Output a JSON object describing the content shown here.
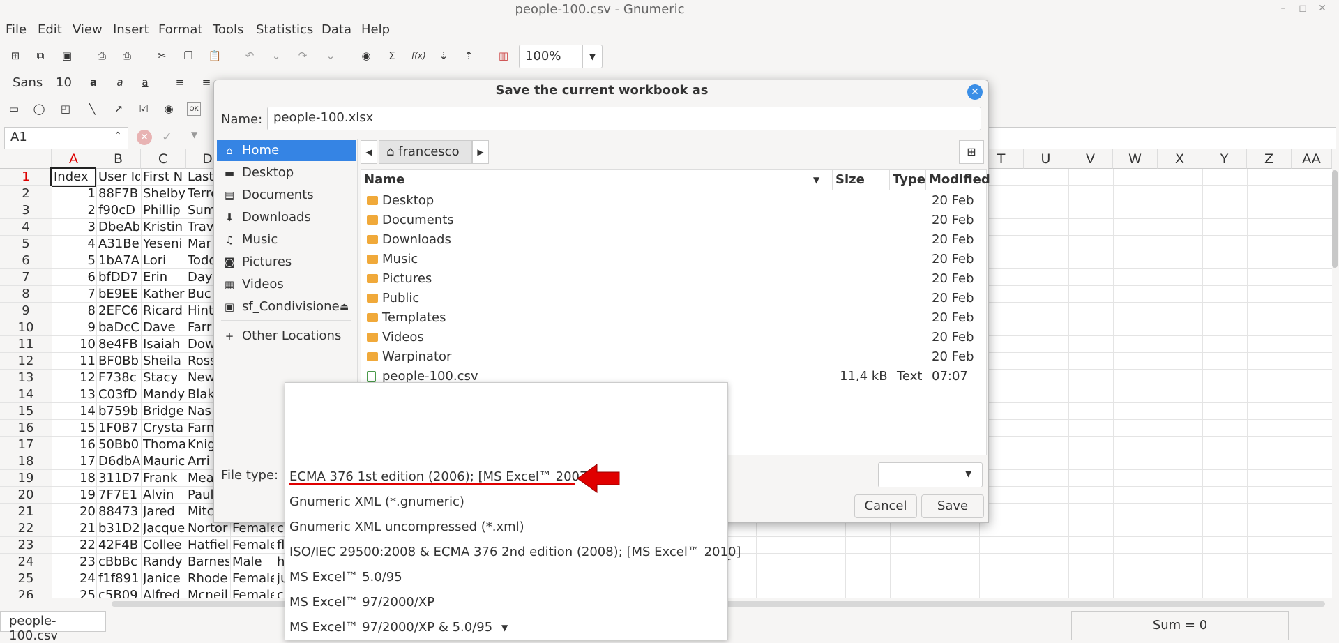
{
  "window": {
    "title": "people-100.csv - Gnumeric"
  },
  "menus": [
    "File",
    "Edit",
    "View",
    "Insert",
    "Format",
    "Tools",
    "Statistics",
    "Data",
    "Help"
  ],
  "toolbar": {
    "zoom": "100%",
    "font_name": "Sans",
    "font_size": "10"
  },
  "cell_ref": "A1",
  "sheet": {
    "columns_left": [
      "A",
      "B",
      "C",
      "D"
    ],
    "columns_right": [
      "T",
      "U",
      "V",
      "W",
      "X",
      "Y",
      "Z",
      "AA"
    ],
    "rows": [
      {
        "n": "1",
        "a": "Index",
        "b": "User Id",
        "c": "First N",
        "d": "Last"
      },
      {
        "n": "2",
        "a": "1",
        "b": "88F7B",
        "c": "Shelby",
        "d": "Terre"
      },
      {
        "n": "3",
        "a": "2",
        "b": "f90cD",
        "c": "Phillip",
        "d": "Sum"
      },
      {
        "n": "4",
        "a": "3",
        "b": "DbeAb",
        "c": "Kristin",
        "d": "Trav"
      },
      {
        "n": "5",
        "a": "4",
        "b": "A31Be",
        "c": "Yeseni",
        "d": "Mar"
      },
      {
        "n": "6",
        "a": "5",
        "b": "1bA7A",
        "c": "Lori",
        "d": "Todd"
      },
      {
        "n": "7",
        "a": "6",
        "b": "bfDD7",
        "c": "Erin",
        "d": "Day"
      },
      {
        "n": "8",
        "a": "7",
        "b": "bE9EE",
        "c": "Kather",
        "d": "Buc"
      },
      {
        "n": "9",
        "a": "8",
        "b": "2EFC6",
        "c": "Ricard",
        "d": "Hint"
      },
      {
        "n": "10",
        "a": "9",
        "b": "baDcC",
        "c": "Dave",
        "d": "Farr"
      },
      {
        "n": "11",
        "a": "10",
        "b": "8e4FB",
        "c": "Isaiah",
        "d": "Dow"
      },
      {
        "n": "12",
        "a": "11",
        "b": "BF0Bb",
        "c": "Sheila",
        "d": "Ross"
      },
      {
        "n": "13",
        "a": "12",
        "b": "F738c",
        "c": "Stacy",
        "d": "New"
      },
      {
        "n": "14",
        "a": "13",
        "b": "C03fD",
        "c": "Mandy",
        "d": "Blak"
      },
      {
        "n": "15",
        "a": "14",
        "b": "b759b",
        "c": "Bridge",
        "d": "Nas"
      },
      {
        "n": "16",
        "a": "15",
        "b": "1F0B7",
        "c": "Crysta",
        "d": "Farn"
      },
      {
        "n": "17",
        "a": "16",
        "b": "50Bb0",
        "c": "Thoma",
        "d": "Knig"
      },
      {
        "n": "18",
        "a": "17",
        "b": "D6dbA",
        "c": "Mauric",
        "d": "Arri"
      },
      {
        "n": "19",
        "a": "18",
        "b": "311D7",
        "c": "Frank",
        "d": "Mea"
      },
      {
        "n": "20",
        "a": "19",
        "b": "7F7E1",
        "c": "Alvin",
        "d": "Paul"
      },
      {
        "n": "21",
        "a": "20",
        "b": "88473",
        "c": "Jared",
        "d": "Mitc"
      },
      {
        "n": "22",
        "a": "21",
        "b": "b31D2",
        "c": "Jacque",
        "d": "Nortor",
        "e": "Female",
        "f": "c"
      },
      {
        "n": "23",
        "a": "22",
        "b": "42F4B",
        "c": "Collee",
        "d": "Hatfiel",
        "e": "Female",
        "f": "fl"
      },
      {
        "n": "24",
        "a": "23",
        "b": "cBbBc",
        "c": "Randy",
        "d": "Barnes",
        "e": "Male",
        "f": "h",
        "r": "r"
      },
      {
        "n": "25",
        "a": "24",
        "b": "f1f891",
        "c": "Janice",
        "d": "Rhode",
        "e": "Female",
        "f": "ju"
      },
      {
        "n": "26",
        "a": "25",
        "b": "c5B09",
        "c": "Alfred",
        "d": "Mcneil",
        "e": "Female",
        "f": "c"
      }
    ]
  },
  "sheet_tab": "people-100.csv",
  "status": {
    "sum": "Sum = 0"
  },
  "dialog": {
    "title": "Save the current workbook as",
    "name_label": "Name:",
    "name_value": "people-100.xlsx",
    "places": [
      "Home",
      "Desktop",
      "Documents",
      "Downloads",
      "Music",
      "Pictures",
      "Videos",
      "sf_Condivisione"
    ],
    "other_locations": "Other Locations",
    "path": "francesco",
    "columns": {
      "name": "Name",
      "size": "Size",
      "type": "Type",
      "modified": "Modified"
    },
    "files": [
      {
        "name": "Desktop",
        "size": "",
        "type": "",
        "modified": "20 Feb"
      },
      {
        "name": "Documents",
        "size": "",
        "type": "",
        "modified": "20 Feb"
      },
      {
        "name": "Downloads",
        "size": "",
        "type": "",
        "modified": "20 Feb"
      },
      {
        "name": "Music",
        "size": "",
        "type": "",
        "modified": "20 Feb"
      },
      {
        "name": "Pictures",
        "size": "",
        "type": "",
        "modified": "20 Feb"
      },
      {
        "name": "Public",
        "size": "",
        "type": "",
        "modified": "20 Feb"
      },
      {
        "name": "Templates",
        "size": "",
        "type": "",
        "modified": "20 Feb"
      },
      {
        "name": "Videos",
        "size": "",
        "type": "",
        "modified": "20 Feb"
      },
      {
        "name": "Warpinator",
        "size": "",
        "type": "",
        "modified": "20 Feb"
      },
      {
        "name": "people-100.csv",
        "size": "11,4 kB",
        "type": "Text",
        "modified": "07:07"
      }
    ],
    "file_type_label": "File type:",
    "cancel": "Cancel",
    "save": "Save",
    "file_types": [
      "ECMA 376 1st edition (2006); [MS Excel™ 2007]",
      "Gnumeric XML (*.gnumeric)",
      "Gnumeric XML uncompressed (*.xml)",
      "ISO/IEC 29500:2008 & ECMA 376 2nd edition (2008); [MS Excel™ 2010]",
      "MS Excel™ 5.0/95",
      "MS Excel™ 97/2000/XP",
      "MS Excel™ 97/2000/XP & 5.0/95"
    ],
    "selected_type_index": 0
  },
  "annotation": {
    "underline_color": "#e00000",
    "arrow_color": "#e00000"
  }
}
